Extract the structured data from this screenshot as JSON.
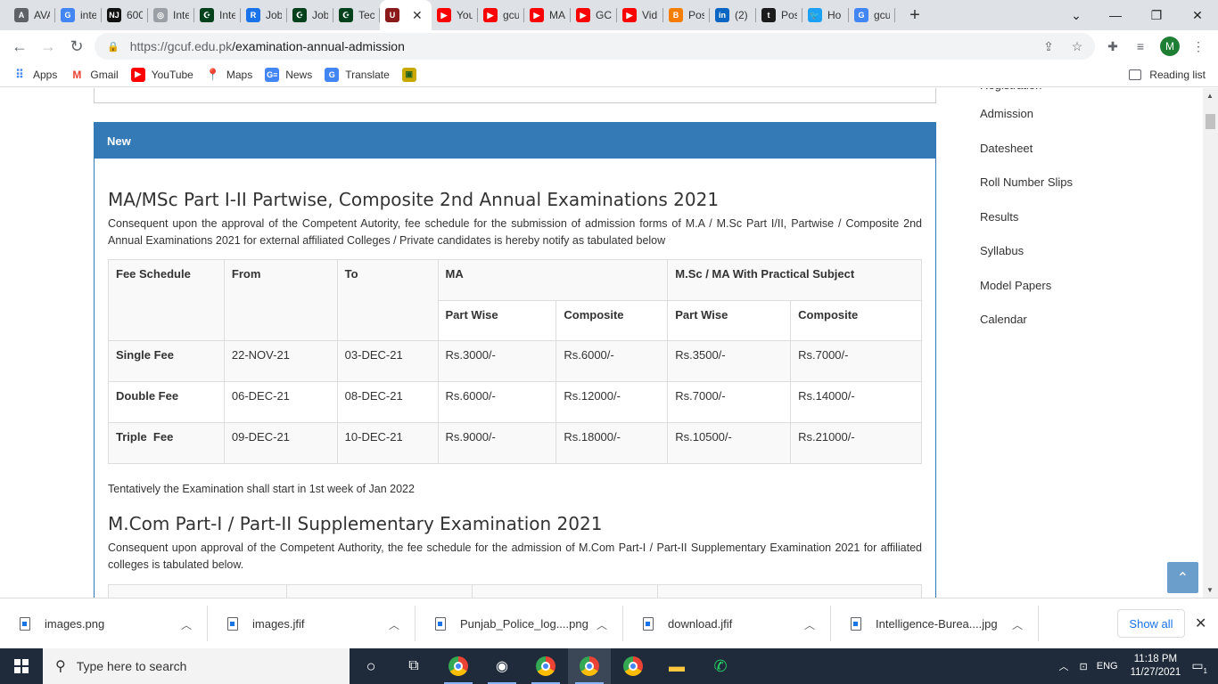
{
  "browser": {
    "tabs": [
      {
        "label": "AVA",
        "fav": "A",
        "color": "#5f6368"
      },
      {
        "label": "inte",
        "fav": "G",
        "color": "#4285f4"
      },
      {
        "label": "600",
        "fav": "NJ",
        "color": "#111111"
      },
      {
        "label": "Inte",
        "fav": "◎",
        "color": "#9aa0a6"
      },
      {
        "label": "Inte",
        "fav": "☪",
        "color": "#01411c"
      },
      {
        "label": "Job",
        "fav": "R",
        "color": "#1a73e8"
      },
      {
        "label": "Job",
        "fav": "☪",
        "color": "#01411c"
      },
      {
        "label": "Tec",
        "fav": "☪",
        "color": "#01411c"
      },
      {
        "label": "",
        "fav": "U",
        "color": "#8b1a1a",
        "active": true
      },
      {
        "label": "You",
        "fav": "▶",
        "color": "#ff0000"
      },
      {
        "label": "gcu",
        "fav": "▶",
        "color": "#ff0000"
      },
      {
        "label": "MA",
        "fav": "▶",
        "color": "#ff0000"
      },
      {
        "label": "GCI",
        "fav": "▶",
        "color": "#ff0000"
      },
      {
        "label": "Vid",
        "fav": "▶",
        "color": "#ff0000"
      },
      {
        "label": "Pos",
        "fav": "B",
        "color": "#f57d00"
      },
      {
        "label": "(2)",
        "fav": "in",
        "color": "#0a66c2"
      },
      {
        "label": "Pos",
        "fav": "t",
        "color": "#1b1b1b"
      },
      {
        "label": "Ho",
        "fav": "🐦",
        "color": "#1da1f2"
      },
      {
        "label": "gcu",
        "fav": "G",
        "color": "#4285f4"
      }
    ],
    "url_host": "https://gcuf.edu.pk",
    "url_path": "/examination-annual-admission",
    "avatar_letter": "M",
    "bookmarks": [
      {
        "label": "Apps",
        "icon": "apps-icon"
      },
      {
        "label": "Gmail",
        "icon": "gmail-icon"
      },
      {
        "label": "YouTube",
        "icon": "youtube-icon"
      },
      {
        "label": "Maps",
        "icon": "maps-icon"
      },
      {
        "label": "News",
        "icon": "news-icon"
      },
      {
        "label": "Translate",
        "icon": "translate-icon"
      },
      {
        "label": "",
        "icon": "image-bookmark-icon"
      }
    ],
    "reading_list": "Reading list"
  },
  "page": {
    "panel_title": "New",
    "section1": {
      "title": "MA/MSc Part I-II Partwise, Composite 2nd Annual Examinations 2021",
      "intro": "Consequent upon the approval of the Competent Autority, fee schedule for the submission of admission forms of M.A / M.Sc Part I/II, Partwise / Composite 2nd Annual Examinations 2021 for external affiliated Colleges / Private candidates  is hereby notify as tabulated below",
      "headers": {
        "fee_schedule": "Fee Schedule",
        "from": "From",
        "to": "To",
        "ma": "MA",
        "msc": "M.Sc / MA With Practical Subject",
        "part_wise": "Part Wise",
        "composite": "Composite"
      },
      "rows": [
        {
          "label": "Single Fee",
          "from": "22-NOV-21",
          "to": "03-DEC-21",
          "ma_pw": "Rs.3000/-",
          "ma_c": "Rs.6000/-",
          "msc_pw": "Rs.3500/-",
          "msc_c": "Rs.7000/-"
        },
        {
          "label": "Double Fee",
          "from": "06-DEC-21",
          "to": "08-DEC-21",
          "ma_pw": "Rs.6000/-",
          "ma_c": "Rs.12000/-",
          "msc_pw": "Rs.7000/-",
          "msc_c": "Rs.14000/-"
        },
        {
          "label": "Triple  Fee",
          "from": "09-DEC-21",
          "to": "10-DEC-21",
          "ma_pw": "Rs.9000/-",
          "ma_c": "Rs.18000/-",
          "msc_pw": "Rs.10500/-",
          "msc_c": "Rs.21000/-"
        }
      ],
      "note": "Tentatively the Examination shall start in 1st week of Jan 2022"
    },
    "section2": {
      "title": "M.Com Part-I / Part-II Supplementary Examination 2021",
      "intro": "Consequent upon approval of the Competent Authority, the fee schedule for the admission of M.Com Part-I / Part-II Supplementary Examination 2021 for affiliated colleges is tabulated below."
    },
    "sidebar": {
      "partial": "Registration",
      "items": [
        "Admission",
        "Datesheet",
        "Roll Number Slips",
        "Results",
        "Syllabus",
        "Model Papers",
        "Calendar"
      ]
    }
  },
  "downloads": {
    "items": [
      "images.png",
      "images.jfif",
      "Punjab_Police_log....png",
      "download.jfif",
      "Intelligence-Burea....jpg"
    ],
    "show_all": "Show all"
  },
  "taskbar": {
    "search_placeholder": "Type here to search",
    "language": "ENG",
    "time": "11:18 PM",
    "date": "11/27/2021",
    "notification_count": "1"
  }
}
